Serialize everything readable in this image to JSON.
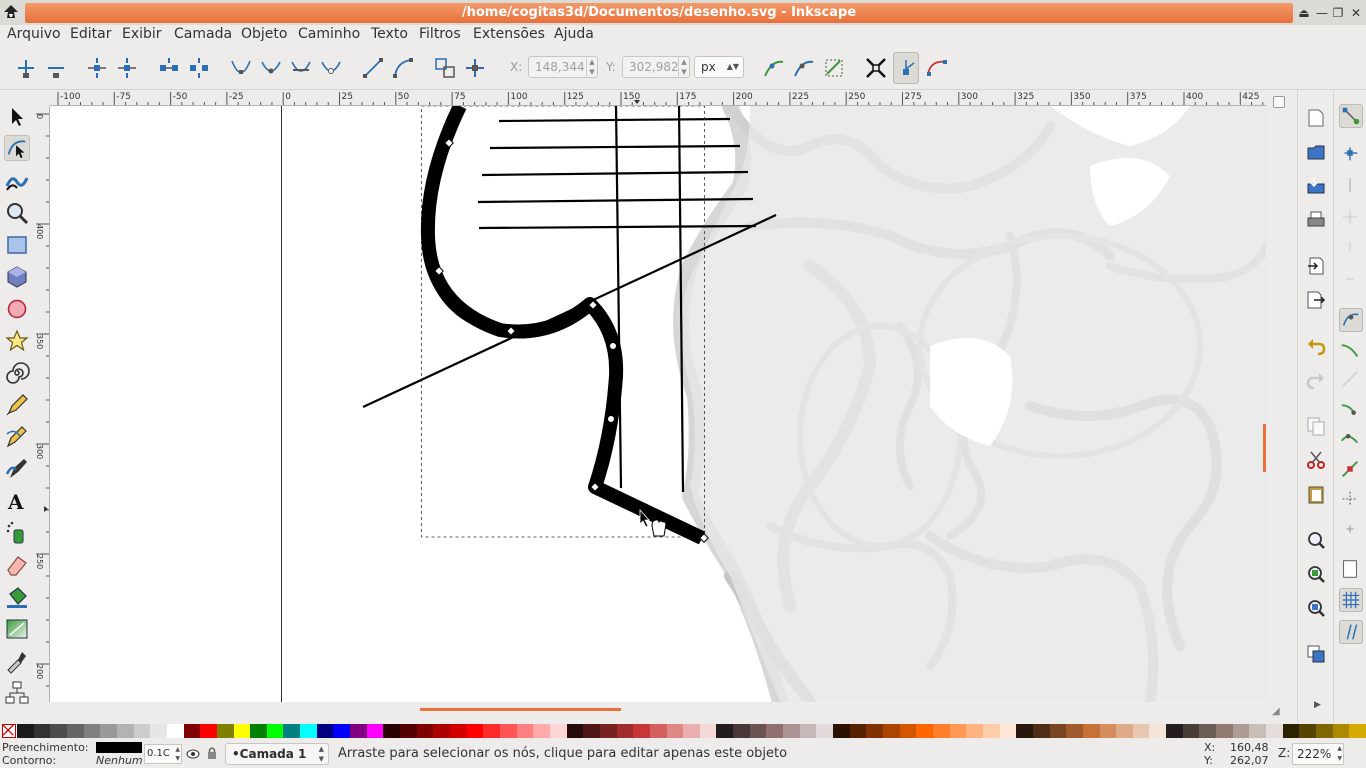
{
  "window": {
    "title": "/home/cogitas3d/Documentos/desenho.svg - Inkscape",
    "controls": [
      "⏏",
      "—",
      "❐",
      "✕"
    ]
  },
  "menu": [
    "Arquivo",
    "Editar",
    "Exibir",
    "Camada",
    "Objeto",
    "Caminho",
    "Texto",
    "Filtros",
    "Extensões",
    "Ajuda"
  ],
  "node_toolbar": {
    "x_label": "X:",
    "x_value": "148,344",
    "y_label": "Y:",
    "y_value": "302,982",
    "unit": "px"
  },
  "ruler": {
    "top_labels": [
      "-100",
      "-75",
      "-50",
      "-25",
      "0",
      "25",
      "50",
      "75",
      "100",
      "125",
      "150",
      "175",
      "200",
      "225",
      "250",
      "275",
      "300",
      "325",
      "350",
      "375",
      "400",
      "425"
    ],
    "left_labels": [
      "0",
      "400",
      "350",
      "300",
      "250",
      "200"
    ]
  },
  "palette_colors": [
    "#1a1a1a",
    "#333333",
    "#4d4d4d",
    "#666666",
    "#808080",
    "#999999",
    "#b3b3b3",
    "#cccccc",
    "#e6e6e6",
    "#ffffff",
    "#800000",
    "#ff0000",
    "#808000",
    "#ffff00",
    "#008000",
    "#00ff00",
    "#008080",
    "#00ffff",
    "#000080",
    "#0000ff",
    "#800080",
    "#ff00ff",
    "#2b0000",
    "#550000",
    "#800000",
    "#aa0000",
    "#d40000",
    "#ff0000",
    "#ff2a2a",
    "#ff5555",
    "#ff8080",
    "#ffaaaa",
    "#ffd5d5",
    "#280b0b",
    "#501616",
    "#782121",
    "#a02c2c",
    "#c83737",
    "#d35f5f",
    "#de8787",
    "#e9afaf",
    "#f4d7d7",
    "#241c1c",
    "#483737",
    "#6c5353",
    "#916f6f",
    "#ac9393",
    "#c8b7b7",
    "#e3dbdb",
    "#2b1100",
    "#552200",
    "#803300",
    "#aa4400",
    "#d45500",
    "#ff6600",
    "#ff7f2a",
    "#ff9955",
    "#ffb380",
    "#ffccaa",
    "#ffe6d5",
    "#28170b",
    "#502d16",
    "#784421",
    "#a05a2c",
    "#c87137",
    "#d38d5f",
    "#deaa87",
    "#e9c6af",
    "#f4e3d7",
    "#241f1c",
    "#483e37",
    "#6c5d53",
    "#917c6f",
    "#ac9d93",
    "#c8beb7",
    "#e3dedb",
    "#2b2200",
    "#554400",
    "#806600",
    "#aa8800",
    "#d4aa00"
  ],
  "status": {
    "fill_label": "Preenchimento:",
    "stroke_label": "Contorno:",
    "stroke_value": "Nenhum",
    "opacity_value": "0.1C",
    "layer_name": "Camada 1",
    "message": "Arraste para selecionar os nós, clique para editar apenas este objeto",
    "cursor_x_label": "X:",
    "cursor_x": "160,48",
    "cursor_y_label": "Y:",
    "cursor_y": "262,07",
    "zoom_label": "Z:",
    "zoom": "222%"
  }
}
